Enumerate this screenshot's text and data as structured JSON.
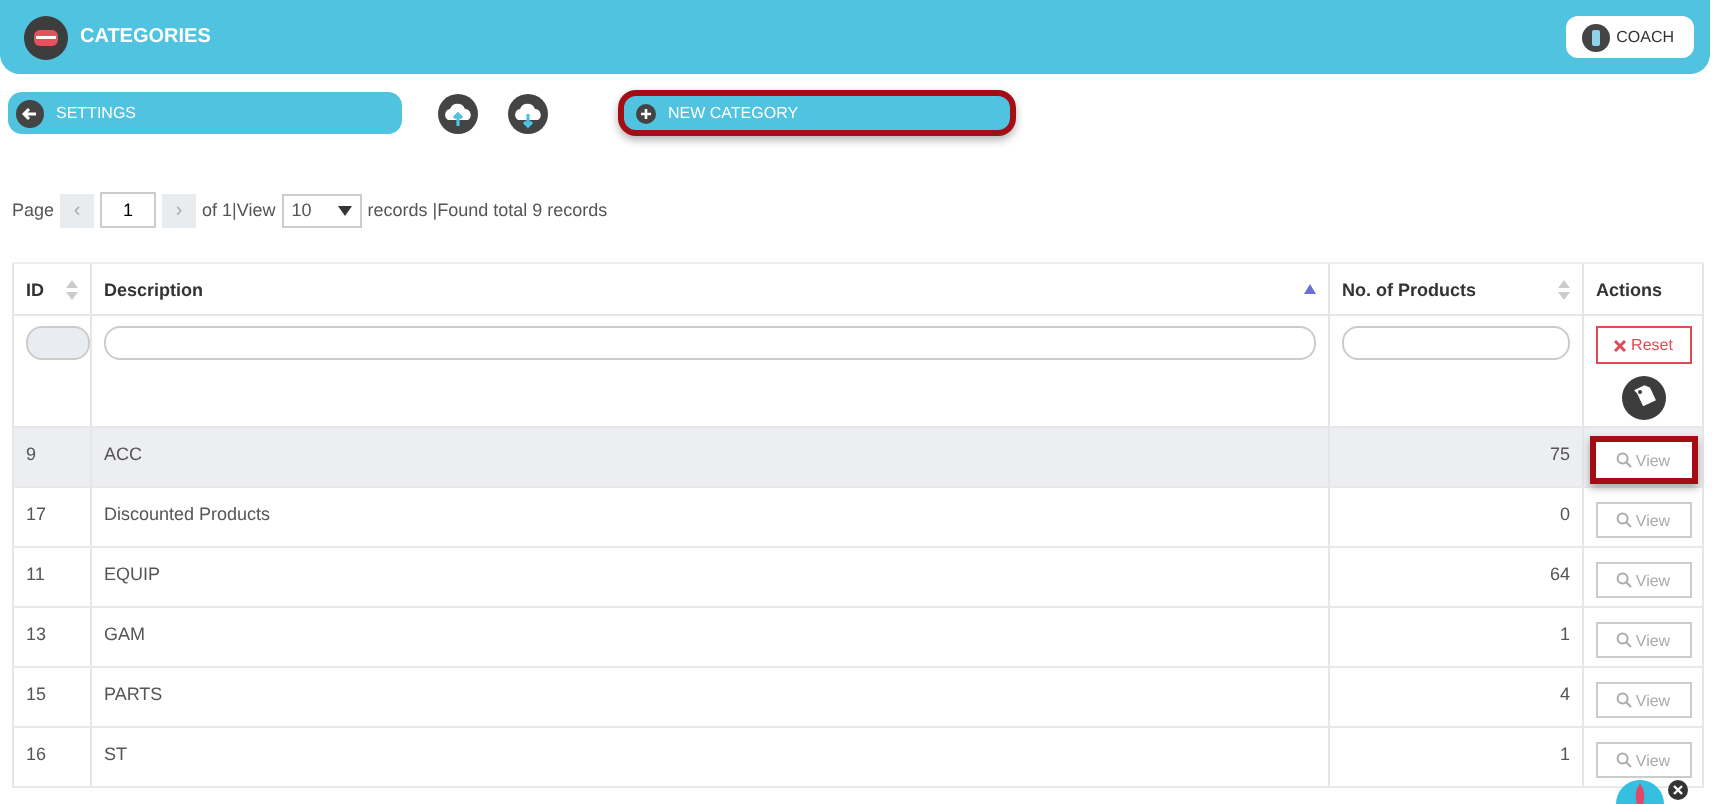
{
  "header": {
    "title": "CATEGORIES",
    "coach_button": "COACH"
  },
  "toolbar": {
    "settings_button": "SETTINGS",
    "new_category": {
      "label": "NEW CATEGORY",
      "highlighted": true
    }
  },
  "pager": {
    "page_label": "Page",
    "prev": "‹",
    "page": "1",
    "next": "›",
    "of_text": "of 1|View",
    "page_size": "10",
    "summary": "records |Found total 9 records"
  },
  "table": {
    "columns": [
      {
        "label": "ID",
        "sortable": true,
        "sorted": false
      },
      {
        "label": "Description",
        "sortable": true,
        "sorted": true
      },
      {
        "label": "No. of Products",
        "sortable": true,
        "sorted": false
      },
      {
        "label": "Actions",
        "sortable": false
      }
    ],
    "reset_button": "Reset",
    "rows": [
      {
        "id": "9",
        "description": "ACC",
        "products": "75",
        "view": "View",
        "selected": true,
        "highlighted": true
      },
      {
        "id": "17",
        "description": "Discounted Products",
        "products": "0",
        "view": "View",
        "selected": false,
        "highlighted": false
      },
      {
        "id": "11",
        "description": "EQUIP",
        "products": "64",
        "view": "View",
        "selected": false,
        "highlighted": false
      },
      {
        "id": "13",
        "description": "GAM",
        "products": "1",
        "view": "View",
        "selected": false,
        "highlighted": false
      },
      {
        "id": "15",
        "description": "PARTS",
        "products": "4",
        "view": "View",
        "selected": false,
        "highlighted": false
      },
      {
        "id": "16",
        "description": "ST",
        "products": "1",
        "view": "View",
        "selected": false,
        "highlighted": false
      }
    ]
  }
}
